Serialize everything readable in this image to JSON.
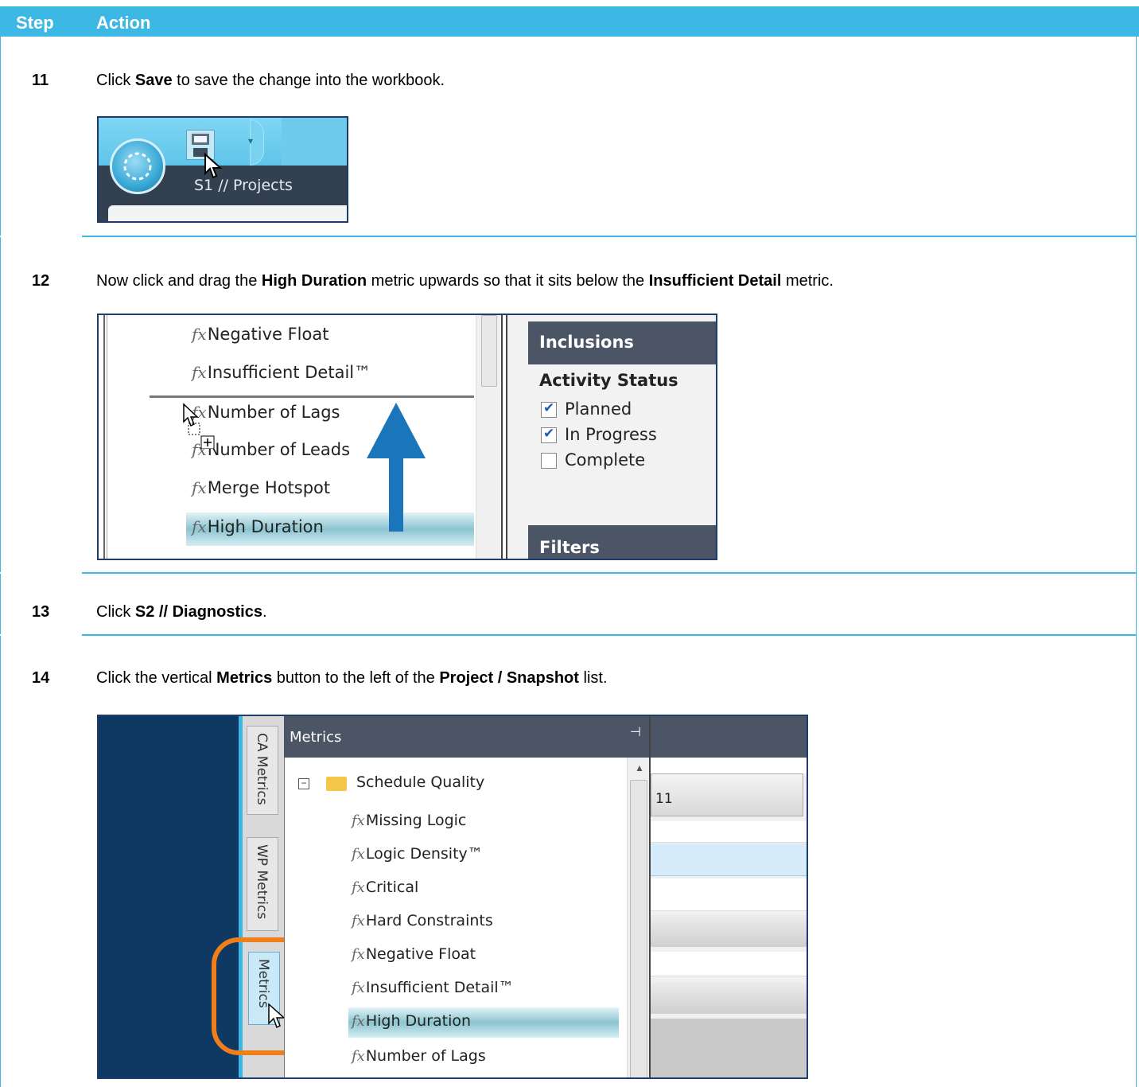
{
  "header": {
    "step": "Step",
    "action": "Action"
  },
  "steps": [
    {
      "num": "11",
      "pre": "Click ",
      "b1": "Save",
      "post": " to save the change into the workbook."
    },
    {
      "num": "12",
      "pre": "Now click and drag the ",
      "b1": "High Duration",
      "mid": " metric upwards so that it sits below the ",
      "b2": "Insufficient Detail",
      "post": " metric."
    },
    {
      "num": "13",
      "pre": "Click ",
      "b1": "S2 // Diagnostics",
      "post": "."
    },
    {
      "num": "14",
      "pre": "Click the vertical ",
      "b1": "Metrics",
      "mid": " button to the left of the ",
      "b2": "Project / Snapshot",
      "post": " list."
    }
  ],
  "shot1": {
    "tab_label": "S1 // Projects"
  },
  "shot2": {
    "metrics": [
      "Negative Float",
      "Insufficient Detail™",
      "Number of Lags",
      "Number of Leads",
      "Merge Hotspot",
      "High Duration"
    ],
    "inclusions": "Inclusions",
    "activity_status": "Activity Status",
    "checks": [
      {
        "label": "Planned",
        "checked": true
      },
      {
        "label": "In Progress",
        "checked": true
      },
      {
        "label": "Complete",
        "checked": false
      }
    ],
    "filters": "Filters",
    "arrow_color": "#1b75bb"
  },
  "shot3": {
    "side_tabs": [
      "CA Metrics",
      "WP Metrics",
      "Metrics"
    ],
    "panel_title": "Metrics",
    "folder": "Schedule Quality",
    "metrics": [
      "Missing Logic",
      "Logic Density™",
      "Critical",
      "Hard Constraints",
      "Negative Float",
      "Insufficient Detail™",
      "High Duration",
      "Number of Lags"
    ],
    "grid_cell": "11",
    "highlight_color": "#f07f1a"
  },
  "colors": {
    "accent": "#3db7e4"
  }
}
